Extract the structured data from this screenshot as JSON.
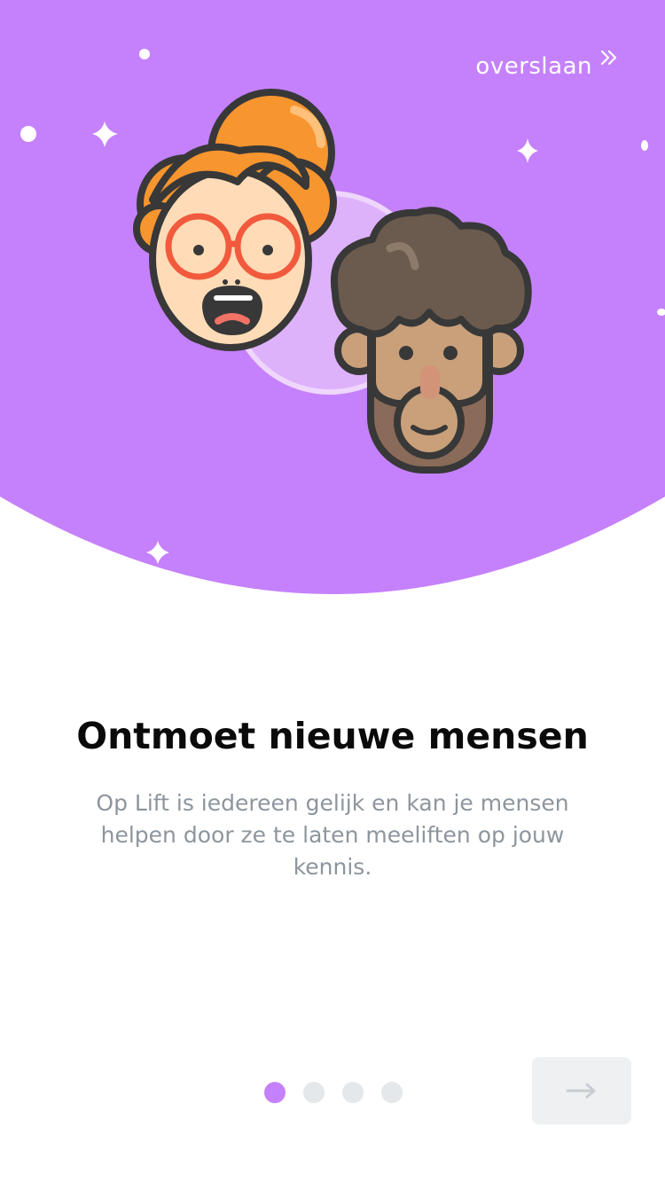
{
  "onboarding": {
    "skip_label": "overslaan",
    "skip_icon": "double-chevron-right-icon",
    "title": "Ontmoet nieuwe mensen",
    "description": "Op Lift is iedereen gelijk en kan je mensen helpen door ze te laten meeliften op jouw kennis.",
    "illustration": "two-people-faces-illustration",
    "pagination": {
      "current": 1,
      "total": 4
    },
    "next_icon": "arrow-right-icon"
  },
  "colors": {
    "hero_background": "#c581fb",
    "active_dot": "#c581fb",
    "inactive_dot": "#e4e8ea",
    "title": "#0a0a0a",
    "description": "#8d959d",
    "next_button_bg": "#eef0f2",
    "next_arrow": "#c8ced3"
  }
}
